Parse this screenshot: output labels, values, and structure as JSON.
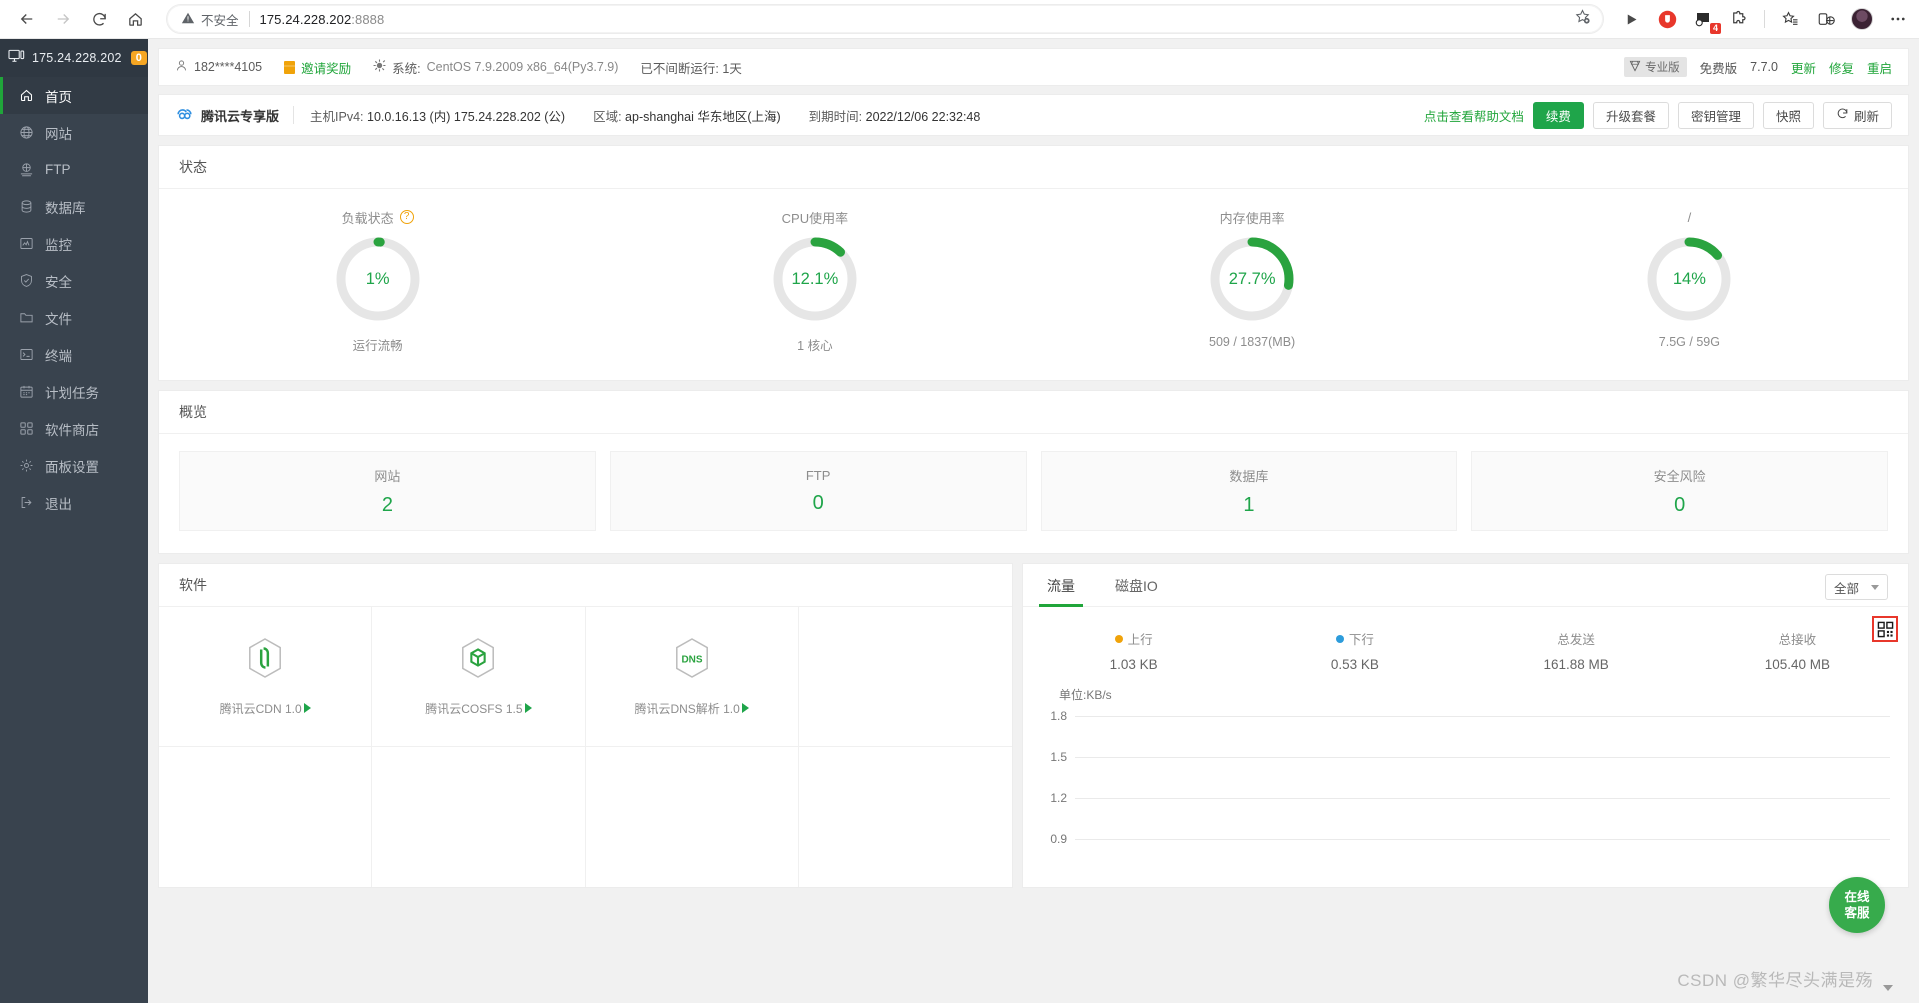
{
  "browser": {
    "back_icon": "back-arrow-icon",
    "forward_icon": "forward-arrow-icon",
    "reload_icon": "reload-icon",
    "home_icon": "home-icon",
    "security_label": "不安全",
    "url_host": "175.24.228.202",
    "url_port": ":8888",
    "bookmark_icon": "add-bookmark-star-icon",
    "toolbar_icons": [
      "play-icon",
      "opera-vpn-icon",
      "extension-count-icon",
      "puzzle-extension-icon",
      "collections-icon",
      "split-screen-icon",
      "profile-avatar",
      "more-options-icon"
    ],
    "extension_badge": "4"
  },
  "sidebar": {
    "server_ip": "175.24.228.202",
    "badge": "0",
    "items": [
      {
        "label": "首页",
        "icon": "home-icon",
        "active": true
      },
      {
        "label": "网站",
        "icon": "globe-icon",
        "active": false
      },
      {
        "label": "FTP",
        "icon": "ftp-icon",
        "active": false
      },
      {
        "label": "数据库",
        "icon": "database-icon",
        "active": false
      },
      {
        "label": "监控",
        "icon": "monitor-icon",
        "active": false
      },
      {
        "label": "安全",
        "icon": "shield-icon",
        "active": false
      },
      {
        "label": "文件",
        "icon": "folder-icon",
        "active": false
      },
      {
        "label": "终端",
        "icon": "terminal-icon",
        "active": false
      },
      {
        "label": "计划任务",
        "icon": "calendar-icon",
        "active": false
      },
      {
        "label": "软件商店",
        "icon": "grid-apps-icon",
        "active": false
      },
      {
        "label": "面板设置",
        "icon": "gear-icon",
        "active": false
      },
      {
        "label": "退出",
        "icon": "logout-icon",
        "active": false
      }
    ]
  },
  "topinfo": {
    "user": "182****4105",
    "invite": "邀请奖励",
    "system_label": "系统:",
    "system_value": "CentOS 7.9.2009 x86_64(Py3.7.9)",
    "uptime": "已不间断运行: 1天",
    "pro_tag": "专业版",
    "edition": "免费版",
    "version": "7.7.0",
    "update": "更新",
    "repair": "修复",
    "restart": "重启"
  },
  "cloudbar": {
    "brand": "腾讯云专享版",
    "ipv4_label": "主机IPv4:",
    "ipv4_private": "10.0.16.13 (内)",
    "ipv4_public": "175.24.228.202 (公)",
    "region_label": "区域:",
    "region_value": "ap-shanghai 华东地区(上海)",
    "expire_label": "到期时间:",
    "expire_value": "2022/12/06 22:32:48",
    "help_link": "点击查看帮助文档",
    "buttons": [
      "续费",
      "升级套餐",
      "密钥管理",
      "快照",
      "刷新"
    ]
  },
  "status": {
    "title": "状态",
    "gauges": [
      {
        "title": "负载状态",
        "help": "?",
        "value": "1%",
        "percent": 1,
        "sub": "运行流畅"
      },
      {
        "title": "CPU使用率",
        "help": "",
        "value": "12.1%",
        "percent": 12.1,
        "sub": "1 核心"
      },
      {
        "title": "内存使用率",
        "help": "",
        "value": "27.7%",
        "percent": 27.7,
        "sub": "509 / 1837(MB)"
      },
      {
        "title": "/",
        "help": "",
        "value": "14%",
        "percent": 14,
        "sub": "7.5G / 59G"
      }
    ]
  },
  "overview": {
    "title": "概览",
    "cards": [
      {
        "label": "网站",
        "value": "2"
      },
      {
        "label": "FTP",
        "value": "0"
      },
      {
        "label": "数据库",
        "value": "1"
      },
      {
        "label": "安全风险",
        "value": "0"
      }
    ]
  },
  "software": {
    "title": "软件",
    "items": [
      {
        "name": "腾讯云CDN 1.0",
        "icon": "cdn-hex-icon"
      },
      {
        "name": "腾讯云COSFS 1.5",
        "icon": "cosfs-cube-icon"
      },
      {
        "name": "腾讯云DNS解析 1.0",
        "icon": "dns-hex-icon"
      }
    ]
  },
  "traffic": {
    "tabs": [
      {
        "label": "流量",
        "active": true
      },
      {
        "label": "磁盘IO",
        "active": false
      }
    ],
    "filter": "全部",
    "qr_icon": "qr-code-icon",
    "stats": [
      {
        "label": "上行",
        "value": "1.03 KB",
        "dot": "#f0a30a"
      },
      {
        "label": "下行",
        "value": "0.53 KB",
        "dot": "#2d9cdb"
      },
      {
        "label": "总发送",
        "value": "161.88 MB",
        "dot": ""
      },
      {
        "label": "总接收",
        "value": "105.40 MB",
        "dot": ""
      }
    ],
    "chart_data": {
      "type": "line",
      "title": "",
      "unit_label": "单位:KB/s",
      "ylabel": "KB/s",
      "xlabel": "",
      "grid": true,
      "legend_position": "top",
      "yticks": [
        "1.8",
        "1.5",
        "1.2",
        "0.9"
      ],
      "ylim": [
        0.9,
        1.8
      ],
      "x": [],
      "series": [
        {
          "name": "上行",
          "color": "#f0a30a",
          "values": []
        },
        {
          "name": "下行",
          "color": "#2d9cdb",
          "values": []
        }
      ]
    }
  },
  "floating": {
    "cs_line1": "在线",
    "cs_line2": "客服"
  },
  "watermark": "CSDN @繁华尽头满是殇",
  "colors": {
    "accent_green": "#1fa54a",
    "sidebar_bg": "#39434e",
    "badge_orange": "#f6a623",
    "warn_red": "#e8372b"
  }
}
